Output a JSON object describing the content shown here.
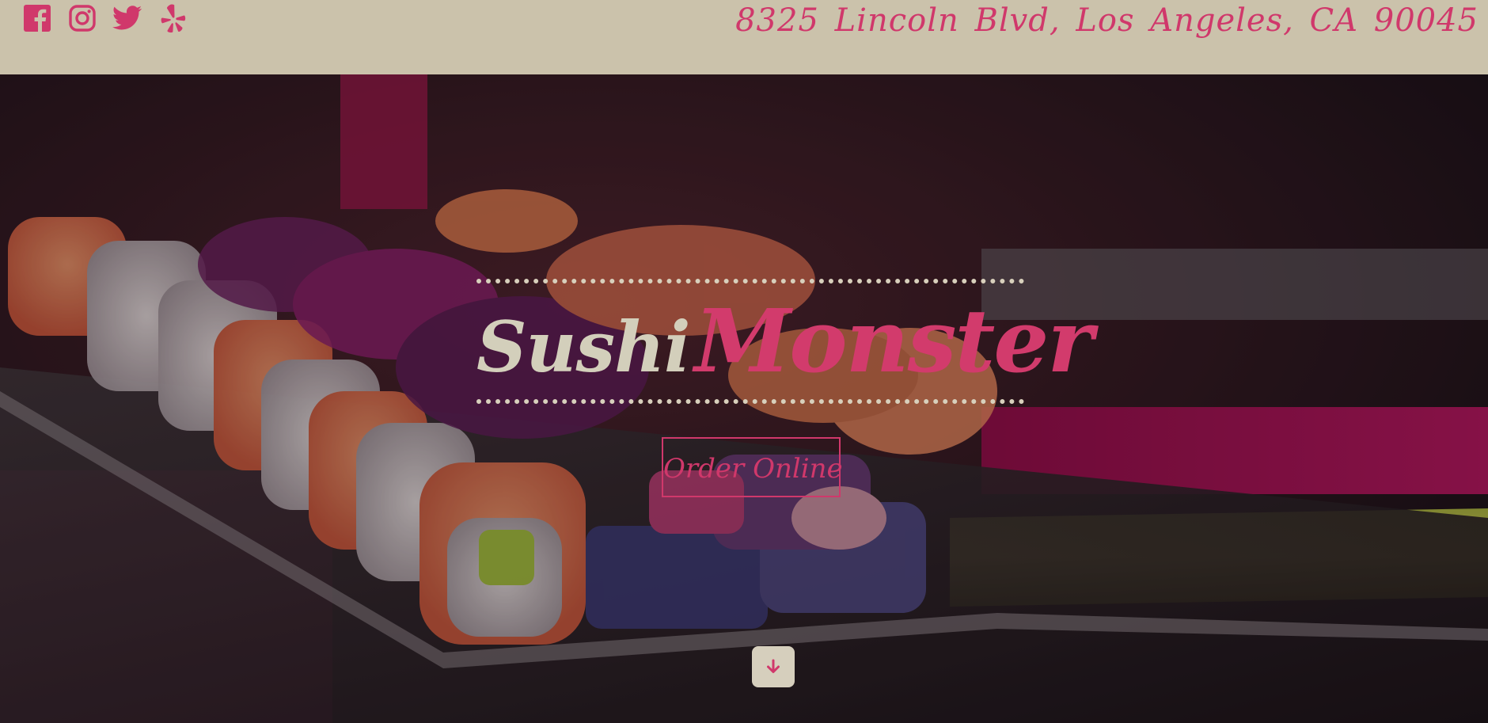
{
  "header": {
    "address": "8325 Lincoln Blvd, Los Angeles, CA 90045",
    "socials": [
      {
        "name": "facebook-icon"
      },
      {
        "name": "instagram-icon"
      },
      {
        "name": "twitter-icon"
      },
      {
        "name": "yelp-icon"
      }
    ]
  },
  "hero": {
    "brand_first": "Sushi",
    "brand_second": "Monster",
    "cta_label": "Order Online",
    "scroll_icon": "arrow-down-icon"
  },
  "colors": {
    "header_bg": "#cbc2ab",
    "accent": "#d0386b",
    "cream": "#d8d0bc"
  }
}
